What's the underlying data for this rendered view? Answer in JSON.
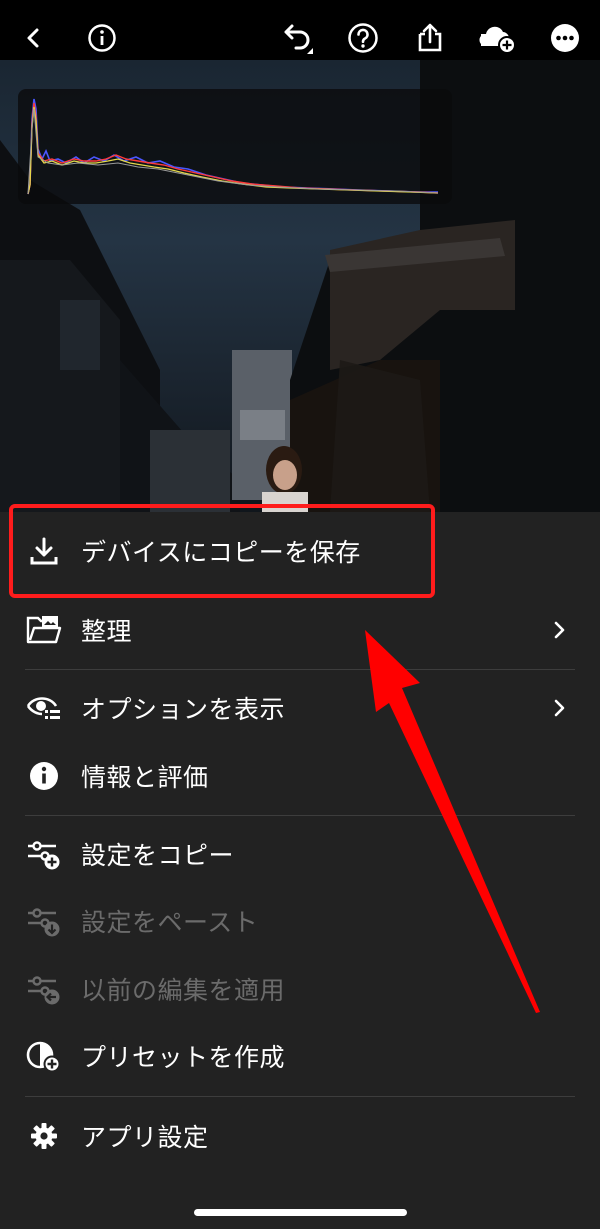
{
  "menu": {
    "items": [
      {
        "label": "デバイスにコピーを保存",
        "icon": "download-icon",
        "enabled": true
      },
      {
        "label": "整理",
        "icon": "organize-icon",
        "enabled": true,
        "submenu": true
      },
      {
        "label": "オプションを表示",
        "icon": "view-options-icon",
        "enabled": true,
        "submenu": true
      },
      {
        "label": "情報と評価",
        "icon": "info-icon",
        "enabled": true
      },
      {
        "label": "設定をコピー",
        "icon": "copy-settings-icon",
        "enabled": true
      },
      {
        "label": "設定をペースト",
        "icon": "paste-settings-icon",
        "enabled": false
      },
      {
        "label": "以前の編集を適用",
        "icon": "apply-previous-icon",
        "enabled": false
      },
      {
        "label": "プリセットを作成",
        "icon": "create-preset-icon",
        "enabled": true
      },
      {
        "label": "アプリ設定",
        "icon": "gear-icon",
        "enabled": true
      }
    ]
  },
  "colors": {
    "menu_bg": "#222222",
    "highlight": "#ff1c1c",
    "arrow": "#ff0000",
    "disabled_text": "#6b6b6b"
  }
}
